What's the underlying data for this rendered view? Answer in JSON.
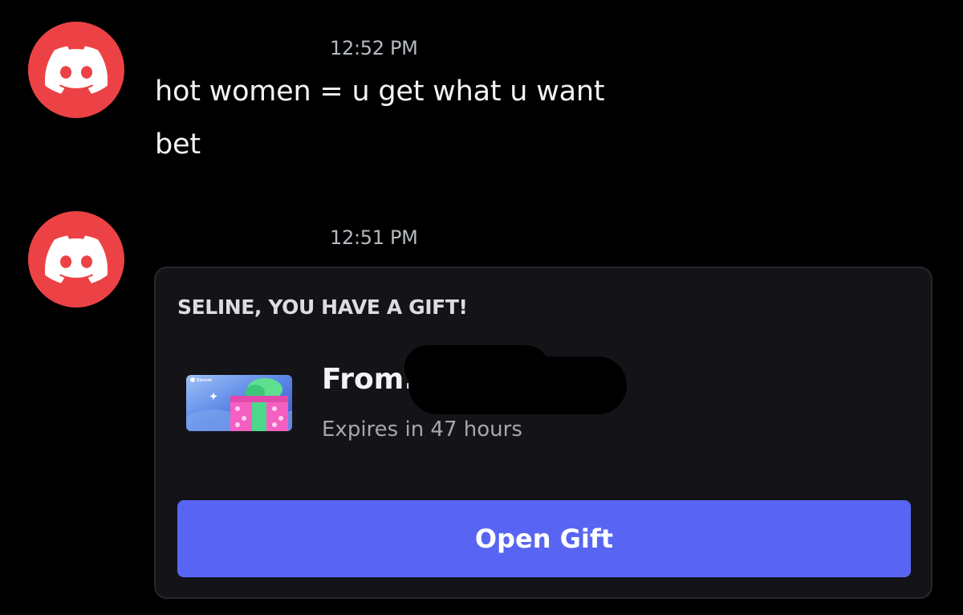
{
  "messages": [
    {
      "avatar_icon": "discord-logo-icon",
      "avatar_color": "#ed4245",
      "timestamp": "12:52 PM",
      "lines": [
        "hot women = u get what u want",
        "bet"
      ]
    },
    {
      "avatar_icon": "discord-logo-icon",
      "avatar_color": "#ed4245",
      "timestamp": "12:51 PM",
      "gift": {
        "heading": "SELINE, YOU HAVE A GIFT!",
        "thumbnail_icon": "nitro-gift-box-icon",
        "thumbnail_brand": "Discord",
        "from_label": "From:",
        "expires": "Expires in 47 hours",
        "button_label": "Open Gift",
        "button_color": "#5865f2"
      }
    }
  ]
}
